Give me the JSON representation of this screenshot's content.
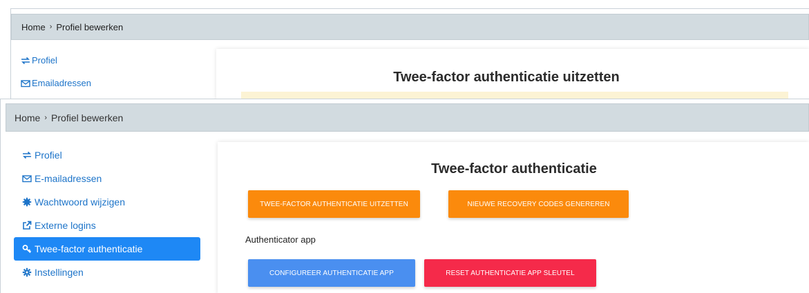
{
  "background_page": {
    "breadcrumb": {
      "home": "Home",
      "separator": "›",
      "current": "Profiel bewerken"
    },
    "nav": [
      {
        "icon": "swap-arrows-icon",
        "label": "Profiel"
      },
      {
        "icon": "envelope-icon",
        "label": "Emailadressen"
      }
    ],
    "card_title": "Twee-factor authenticatie uitzetten"
  },
  "breadcrumb": {
    "home": "Home",
    "separator": "›",
    "current": "Profiel bewerken"
  },
  "sidebar": {
    "items": [
      {
        "icon": "swap-arrows-icon",
        "label": "Profiel",
        "active": false
      },
      {
        "icon": "envelope-icon",
        "label": "E-mailadressen",
        "active": false
      },
      {
        "icon": "asterisk-icon",
        "label": "Wachtwoord wijzigen",
        "active": false
      },
      {
        "icon": "external-link-icon",
        "label": "Externe logins",
        "active": false
      },
      {
        "icon": "key-icon",
        "label": "Twee-factor authenticatie",
        "active": true
      },
      {
        "icon": "gear-icon",
        "label": "Instellingen",
        "active": false
      }
    ]
  },
  "main": {
    "title": "Twee-factor authenticatie",
    "buttons": {
      "disable_2fa": "TWEE-FACTOR AUTHENTICATIE UITZETTEN",
      "new_recovery_codes": "NIEUWE RECOVERY CODES GENEREREN",
      "configure_app": "CONFIGUREER AUTHENTICATIE APP",
      "reset_app_key": "RESET AUTHENTICATIE APP SLEUTEL"
    },
    "authenticator_label": "Authenticator app"
  },
  "colors": {
    "accent_blue": "#1e88f5",
    "link_blue": "#1d74c9",
    "orange": "#fb8a0c",
    "blue_button": "#4a8ff0",
    "red_button": "#f52a4a",
    "breadcrumb_bg": "#d2dbe0"
  }
}
